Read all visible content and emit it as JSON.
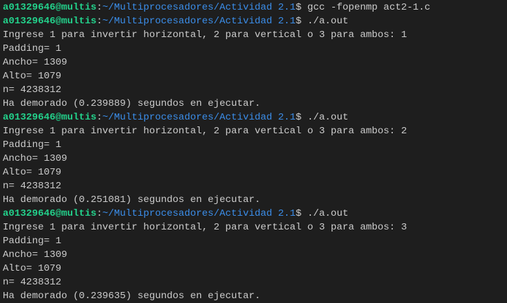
{
  "terminal": {
    "lines": [
      {
        "type": "prompt",
        "user": "a01329646@multis",
        "sep": ":",
        "path": "~/Multiprocesadores/Actividad 2.1",
        "dollar": "$ ",
        "cmd": "gcc -fopenmp act2-1.c"
      },
      {
        "type": "prompt",
        "user": "a01329646@multis",
        "sep": ":",
        "path": "~/Multiprocesadores/Actividad 2.1",
        "dollar": "$ ",
        "cmd": "./a.out"
      },
      {
        "type": "out",
        "text": "Ingrese 1 para invertir horizontal, 2 para vertical o 3 para ambos: 1"
      },
      {
        "type": "out",
        "text": "Padding= 1"
      },
      {
        "type": "out",
        "text": "Ancho= 1309"
      },
      {
        "type": "out",
        "text": "Alto= 1079"
      },
      {
        "type": "out",
        "text": "n= 4238312"
      },
      {
        "type": "out",
        "text": "Ha demorado (0.239889) segundos en ejecutar."
      },
      {
        "type": "prompt",
        "user": "a01329646@multis",
        "sep": ":",
        "path": "~/Multiprocesadores/Actividad 2.1",
        "dollar": "$ ",
        "cmd": "./a.out"
      },
      {
        "type": "out",
        "text": "Ingrese 1 para invertir horizontal, 2 para vertical o 3 para ambos: 2"
      },
      {
        "type": "out",
        "text": "Padding= 1"
      },
      {
        "type": "out",
        "text": "Ancho= 1309"
      },
      {
        "type": "out",
        "text": "Alto= 1079"
      },
      {
        "type": "out",
        "text": "n= 4238312"
      },
      {
        "type": "out",
        "text": "Ha demorado (0.251081) segundos en ejecutar."
      },
      {
        "type": "prompt",
        "user": "a01329646@multis",
        "sep": ":",
        "path": "~/Multiprocesadores/Actividad 2.1",
        "dollar": "$ ",
        "cmd": "./a.out"
      },
      {
        "type": "out",
        "text": "Ingrese 1 para invertir horizontal, 2 para vertical o 3 para ambos: 3"
      },
      {
        "type": "out",
        "text": "Padding= 1"
      },
      {
        "type": "out",
        "text": "Ancho= 1309"
      },
      {
        "type": "out",
        "text": "Alto= 1079"
      },
      {
        "type": "out",
        "text": "n= 4238312"
      },
      {
        "type": "out",
        "text": "Ha demorado (0.239635) segundos en ejecutar."
      }
    ]
  },
  "colors": {
    "background": "#1e1e1e",
    "user": "#23d18b",
    "path": "#3b8eea",
    "text": "#cccccc"
  }
}
